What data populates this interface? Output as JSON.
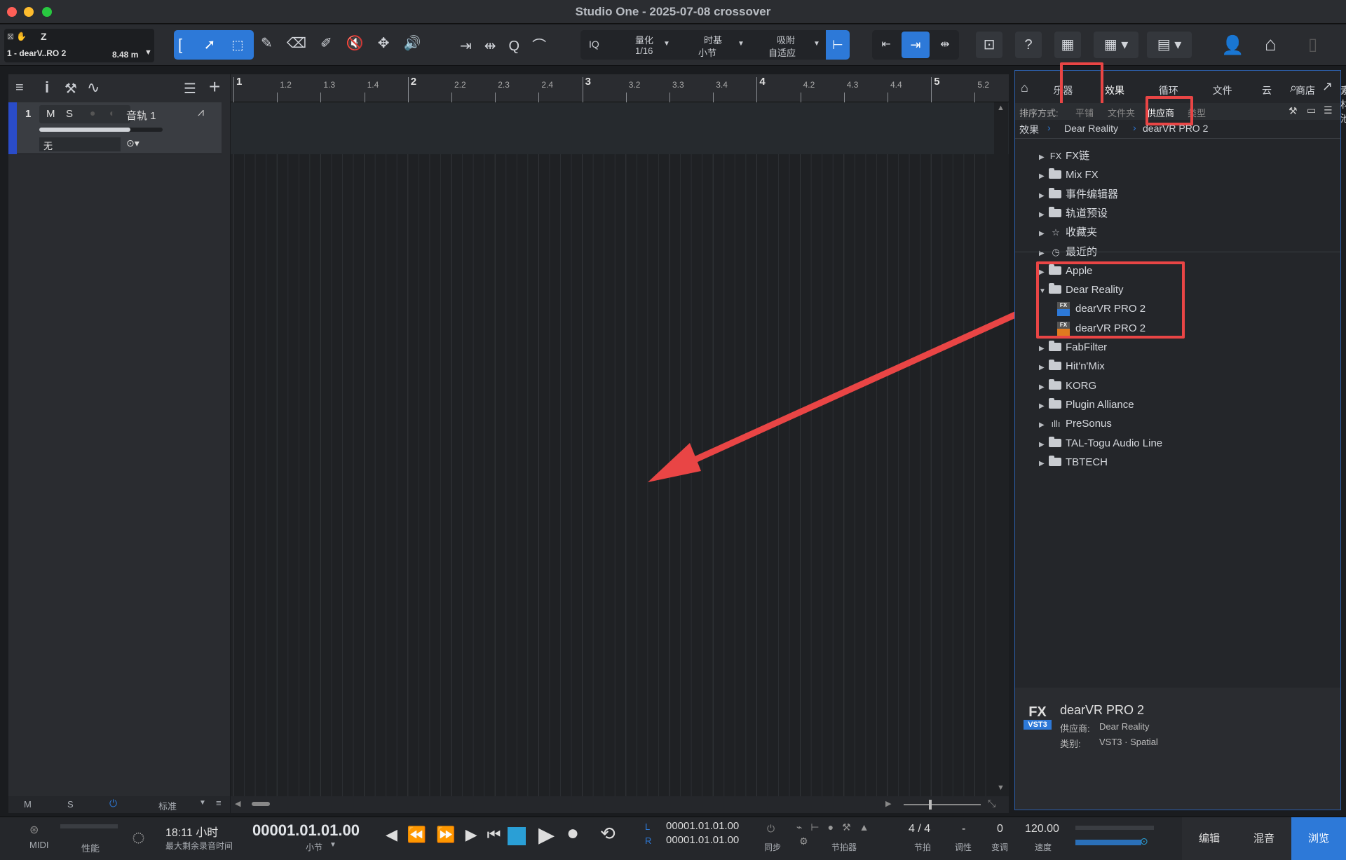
{
  "window": {
    "title": "Studio One - 2025-07-08 crossover"
  },
  "toolbar": {
    "track_info": {
      "letter": "Z",
      "name": "1 - dearV..RO 2",
      "length": "8.48 m"
    },
    "quantize": {
      "label": "量化",
      "value": "1/16"
    },
    "timebase": {
      "label": "时基",
      "value": "小节"
    },
    "snap": {
      "label": "吸附",
      "value": "自适应"
    },
    "iq_label": "IQ",
    "help_label": "?"
  },
  "tracks_panel": {
    "track": {
      "number": "1",
      "mute": "M",
      "solo": "S",
      "name": "音轨 1",
      "input": "无"
    },
    "footer": {
      "m": "M",
      "s": "S",
      "mode": "标准"
    }
  },
  "ruler": {
    "ticks": [
      "1",
      "1.2",
      "1.3",
      "1.4",
      "2",
      "2.2",
      "2.3",
      "2.4",
      "3",
      "3.2",
      "3.3",
      "3.4",
      "4",
      "4.2",
      "4.3",
      "4.4",
      "5",
      "5.2"
    ]
  },
  "browser": {
    "tabs": [
      "乐器",
      "效果",
      "循环",
      "文件",
      "云",
      "商店",
      "素材池"
    ],
    "active_tab": "效果",
    "sort": {
      "label": "排序方式:",
      "options": [
        "平铺",
        "文件夹",
        "供应商",
        "类型"
      ],
      "active": "供应商"
    },
    "breadcrumb": [
      "效果",
      "Dear Reality",
      "dearVR PRO 2"
    ],
    "tree": [
      {
        "label": "FX链",
        "icon": "fx-chain-icon"
      },
      {
        "label": "Mix FX",
        "icon": "folder-icon"
      },
      {
        "label": "事件编辑器",
        "icon": "folder-icon"
      },
      {
        "label": "轨道预设",
        "icon": "folder-icon"
      },
      {
        "label": "收藏夹",
        "icon": "star-icon"
      },
      {
        "label": "最近的",
        "icon": "clock-icon"
      },
      {
        "label": "Apple",
        "icon": "folder-icon"
      },
      {
        "label": "Dear Reality",
        "icon": "folder-open-icon",
        "expanded": true
      },
      {
        "label": "dearVR PRO 2",
        "icon": "vst3-icon",
        "child": true
      },
      {
        "label": "dearVR PRO 2",
        "icon": "au-icon",
        "child": true
      },
      {
        "label": "FabFilter",
        "icon": "folder-icon"
      },
      {
        "label": "Hit'n'Mix",
        "icon": "folder-icon"
      },
      {
        "label": "KORG",
        "icon": "folder-icon"
      },
      {
        "label": "Plugin Alliance",
        "icon": "folder-icon"
      },
      {
        "label": "PreSonus",
        "icon": "presonus-icon"
      },
      {
        "label": "TAL-Togu Audio Line",
        "icon": "folder-icon"
      },
      {
        "label": "TBTECH",
        "icon": "folder-icon"
      }
    ],
    "info": {
      "name": "dearVR PRO 2",
      "vendor_label": "供应商:",
      "vendor": "Dear Reality",
      "category_label": "类别:",
      "category": "VST3 · Spatial",
      "badge_top": "FX",
      "badge_bottom": "VST3"
    }
  },
  "transport": {
    "midi": "MIDI",
    "perf": "性能",
    "record_time": "18:11 小时",
    "record_time_label": "最大剩余录音时间",
    "position": "00001.01.01.00",
    "position_unit": "小节",
    "loop_l": "00001.01.01.00",
    "loop_r": "00001.01.01.00",
    "l": "L",
    "r": "R",
    "sync": "同步",
    "metronome": "节拍器",
    "signature": "4 / 4",
    "signature_label": "节拍",
    "key": "-",
    "key_label": "调性",
    "transpose": "0",
    "transpose_label": "变调",
    "tempo": "120.00",
    "tempo_label": "速度",
    "edit": "编辑",
    "mix": "混音",
    "browse": "浏览"
  },
  "colors": {
    "accent": "#2d79d8",
    "highlight": "#e94545"
  }
}
